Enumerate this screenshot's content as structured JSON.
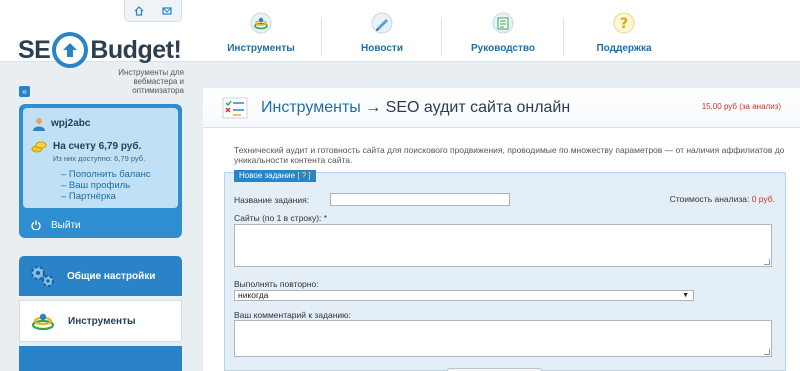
{
  "header": {
    "logo_prefix": "SE",
    "logo_suffix": "Budget!",
    "tagline": "Инструменты для вебмастера и оптимизатора",
    "nav": [
      {
        "label": "Инструменты",
        "icon": "tools-icon"
      },
      {
        "label": "Новости",
        "icon": "pencil-icon"
      },
      {
        "label": "Руководство",
        "icon": "manual-icon"
      },
      {
        "label": "Поддержка",
        "icon": "question-icon"
      }
    ]
  },
  "sidebar": {
    "collapse_label": "«",
    "username": "wpj2abc",
    "balance": "На счету 6,79 руб.",
    "available": "Из них доступно: 6,79 руб.",
    "links": [
      "– Пополнить баланс",
      "– Ваш профиль",
      "– Партнёрка"
    ],
    "logout": "Выйти",
    "menu": [
      {
        "label": "Общие настройки",
        "icon": "gears-icon"
      },
      {
        "label": "Инструменты",
        "icon": "tools-icon"
      }
    ]
  },
  "main": {
    "title_section": "Инструменты",
    "title_arrow": " → ",
    "title_page": "SEO аудит сайта онлайн",
    "price": "15,00 руб (за анализ)",
    "description": "Технический аудит и готовность сайта для поискового продвижения, проводимые по множеству параметров — от наличия аффилиатов до уникальности контента сайта.",
    "form": {
      "tab_label": "Новое задание",
      "tab_help": "[ ? ]",
      "name_label": "Название задания:",
      "name_value": "",
      "cost_label": "Стоимость анализа:",
      "cost_value": "0 руб.",
      "sites_label": "Сайты (по 1 в строку): *",
      "repeat_label": "Выполнять повторно:",
      "repeat_value": "никогда",
      "comment_label": "Ваш комментарий к заданию:"
    }
  },
  "colors": {
    "accent": "#2b83c7",
    "title": "#1f6ea8",
    "price": "#c0392b",
    "panel_bg": "#e4eef7"
  }
}
